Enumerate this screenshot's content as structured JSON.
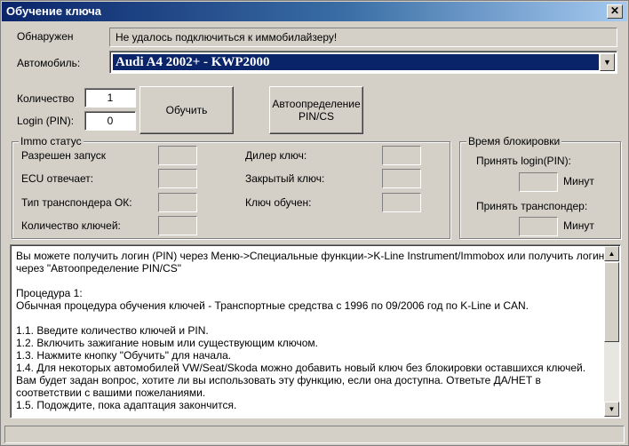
{
  "window": {
    "title": "Обучение ключа",
    "close_glyph": "✕"
  },
  "header": {
    "detected_label": "Обнаружен",
    "status_message": "Не удалось подключиться к иммобилайзеру!",
    "car_label": "Автомобиль:",
    "car_selected": "Audi A4 2002+ - KWP2000"
  },
  "inputs": {
    "quantity_label": "Количество",
    "quantity_value": "1",
    "login_label": "Login (PIN):",
    "login_value": "0"
  },
  "buttons": {
    "learn": "Обучить",
    "autodetect_line1": "Автоопределение",
    "autodetect_line2": "PIN/CS"
  },
  "immo": {
    "legend": "Immo статус",
    "left_items": [
      "Разрешен запуск",
      "ECU отвечает:",
      "Тип транспондера ОК:",
      "Количество ключей:"
    ],
    "right_items": [
      "Дилер ключ:",
      "Закрытый ключ:",
      "Ключ обучен:"
    ]
  },
  "lock_time": {
    "legend": "Время блокировки",
    "accept_login_label": "Принять login(PIN):",
    "accept_login_unit": "Минут",
    "accept_transponder_label": "Принять транспондер:",
    "accept_transponder_unit": "Минут"
  },
  "instructions": [
    "Вы можете получить логин (PIN) через Меню->Специальные функции->K-Line Instrument/Immobox или получить логин через \"Автоопределение PIN/CS\"",
    "",
    "Процедура 1:",
    "Обычная процедура обучения ключей - Транспортные средства с 1996 по 09/2006 год по K-Line и CAN.",
    "",
    "1.1. Введите количество ключей и PIN.",
    "1.2. Включить зажигание новым или существующим ключом.",
    "1.3. Нажмите кнопку \"Обучить\" для начала.",
    "1.4. Для некоторых автомобилей VW/Seat/Skoda можно добавить новый ключ без блокировки оставшихся ключей. Вам будет задан вопрос, хотите ли вы использовать эту функцию, если она доступна. Ответьте ДА/НЕТ в соответствии с вашими пожеланиями.",
    "1.5. Подождите, пока адаптация закончится."
  ],
  "scrollbar": {
    "up_glyph": "▲",
    "down_glyph": "▼",
    "dropdown_glyph": "▼"
  },
  "colors": {
    "title_start": "#0a246a",
    "title_end": "#a6caf0",
    "face": "#d4d0c8",
    "selection": "#0a246a"
  }
}
